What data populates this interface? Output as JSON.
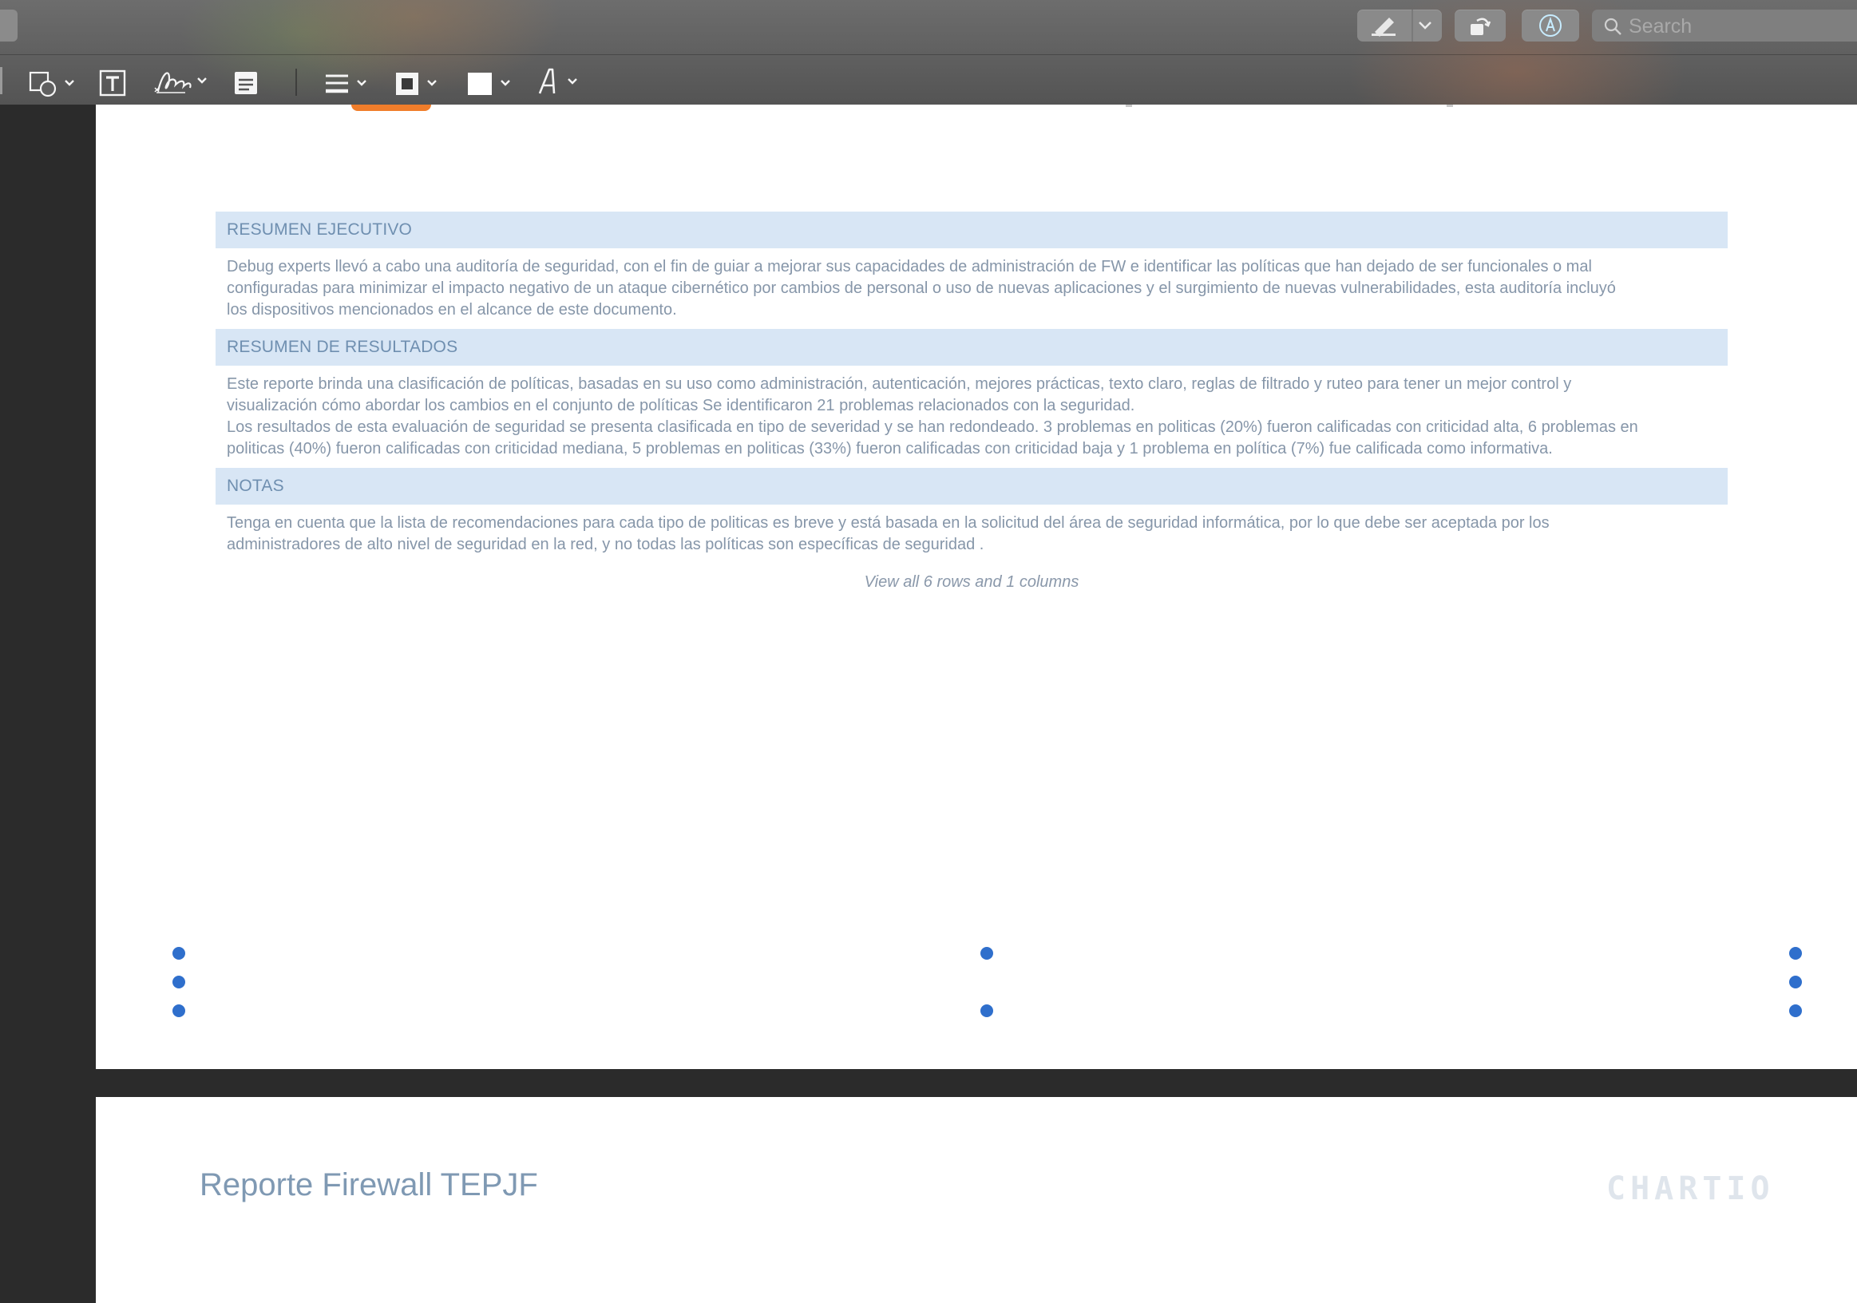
{
  "toolbar": {
    "search_placeholder": "Search",
    "icons": [
      "highlighter-icon",
      "rotate-icon",
      "markup-icon",
      "search-icon",
      "shapes-icon",
      "text-box-icon",
      "signature-icon",
      "note-icon",
      "line-style-icon",
      "border-color-icon",
      "fill-color-icon",
      "font-icon"
    ]
  },
  "report": {
    "rows": [
      {
        "header": "RESUMEN EJECUTIVO",
        "body": "Debug experts llevó a cabo una auditoría de seguridad, con el fin de guiar a mejorar sus capacidades de administración de FW e identificar las políticas que han dejado de ser funcionales o mal\nconfiguradas para minimizar el impacto negativo de un ataque cibernético por cambios de personal o uso de nuevas aplicaciones y el surgimiento de nuevas vulnerabilidades, esta auditoría incluyó\nlos dispositivos mencionados en el alcance de este documento."
      },
      {
        "header": "RESUMEN DE RESULTADOS",
        "body": "Este reporte brinda una clasificación de políticas, basadas en su uso como administración, autenticación, mejores prácticas, texto claro, reglas de filtrado y ruteo para tener un mejor control y\nvisualización cómo abordar los cambios en el conjunto de políticas Se identificaron 21 problemas relacionados con la seguridad.\nLos resultados de esta evaluación de seguridad se presenta clasificada en tipo de severidad y se han redondeado. 3 problemas en politicas (20%) fueron calificadas con criticidad alta, 6 problemas en\npoliticas (40%) fueron calificadas con criticidad mediana, 5 problemas en politicas (33%) fueron calificadas con criticidad baja y 1 problema en política (7%) fue calificada como informativa."
      },
      {
        "header": "NOTAS",
        "body": "Tenga en cuenta que la lista de recomendaciones para cada tipo de politicas es breve y está basada en la solicitud del área de seguridad informática, por lo que debe ser aceptada por los\nadministradores de alto nivel de seguridad en la red, y no todas las políticas son específicas de seguridad ."
      }
    ],
    "view_all": "View all 6 rows and 1 columns"
  },
  "footer": {
    "title": "Reporte Firewall TEPJF",
    "brand": "CHARTIO"
  },
  "colors": {
    "header_bg": "#d8e6f5",
    "header_text": "#6f8fb0",
    "handle": "#2f6fcc",
    "accent_orange": "#f07d2a"
  }
}
